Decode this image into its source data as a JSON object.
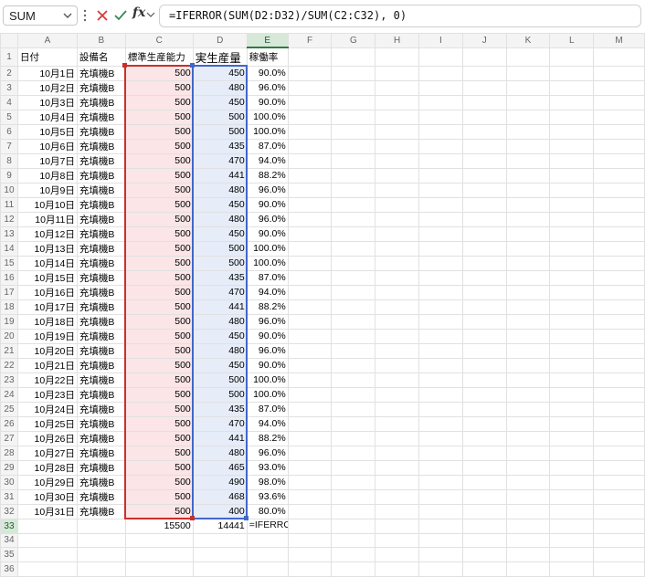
{
  "formula_bar": {
    "name_box": "SUM",
    "formula": "=IFERROR(SUM(D2:D32)/SUM(C2:C32), 0)",
    "fx_label": "fx"
  },
  "columns": [
    "A",
    "B",
    "C",
    "D",
    "E",
    "F",
    "G",
    "H",
    "I",
    "J",
    "K",
    "L",
    "M"
  ],
  "header_row": {
    "date": "日付",
    "equipment": "設備名",
    "std_capacity": "標準生産能力",
    "actual_output": "実生産量",
    "utilization": "稼働率"
  },
  "rows": [
    {
      "date": "10月1日",
      "equipment": "充填機B",
      "std": "500",
      "actual": "450",
      "rate": "90.0%"
    },
    {
      "date": "10月2日",
      "equipment": "充填機B",
      "std": "500",
      "actual": "480",
      "rate": "96.0%"
    },
    {
      "date": "10月3日",
      "equipment": "充填機B",
      "std": "500",
      "actual": "450",
      "rate": "90.0%"
    },
    {
      "date": "10月4日",
      "equipment": "充填機B",
      "std": "500",
      "actual": "500",
      "rate": "100.0%"
    },
    {
      "date": "10月5日",
      "equipment": "充填機B",
      "std": "500",
      "actual": "500",
      "rate": "100.0%"
    },
    {
      "date": "10月6日",
      "equipment": "充填機B",
      "std": "500",
      "actual": "435",
      "rate": "87.0%"
    },
    {
      "date": "10月7日",
      "equipment": "充填機B",
      "std": "500",
      "actual": "470",
      "rate": "94.0%"
    },
    {
      "date": "10月8日",
      "equipment": "充填機B",
      "std": "500",
      "actual": "441",
      "rate": "88.2%"
    },
    {
      "date": "10月9日",
      "equipment": "充填機B",
      "std": "500",
      "actual": "480",
      "rate": "96.0%"
    },
    {
      "date": "10月10日",
      "equipment": "充填機B",
      "std": "500",
      "actual": "450",
      "rate": "90.0%"
    },
    {
      "date": "10月11日",
      "equipment": "充填機B",
      "std": "500",
      "actual": "480",
      "rate": "96.0%"
    },
    {
      "date": "10月12日",
      "equipment": "充填機B",
      "std": "500",
      "actual": "450",
      "rate": "90.0%"
    },
    {
      "date": "10月13日",
      "equipment": "充填機B",
      "std": "500",
      "actual": "500",
      "rate": "100.0%"
    },
    {
      "date": "10月14日",
      "equipment": "充填機B",
      "std": "500",
      "actual": "500",
      "rate": "100.0%"
    },
    {
      "date": "10月15日",
      "equipment": "充填機B",
      "std": "500",
      "actual": "435",
      "rate": "87.0%"
    },
    {
      "date": "10月16日",
      "equipment": "充填機B",
      "std": "500",
      "actual": "470",
      "rate": "94.0%"
    },
    {
      "date": "10月17日",
      "equipment": "充填機B",
      "std": "500",
      "actual": "441",
      "rate": "88.2%"
    },
    {
      "date": "10月18日",
      "equipment": "充填機B",
      "std": "500",
      "actual": "480",
      "rate": "96.0%"
    },
    {
      "date": "10月19日",
      "equipment": "充填機B",
      "std": "500",
      "actual": "450",
      "rate": "90.0%"
    },
    {
      "date": "10月20日",
      "equipment": "充填機B",
      "std": "500",
      "actual": "480",
      "rate": "96.0%"
    },
    {
      "date": "10月21日",
      "equipment": "充填機B",
      "std": "500",
      "actual": "450",
      "rate": "90.0%"
    },
    {
      "date": "10月22日",
      "equipment": "充填機B",
      "std": "500",
      "actual": "500",
      "rate": "100.0%"
    },
    {
      "date": "10月23日",
      "equipment": "充填機B",
      "std": "500",
      "actual": "500",
      "rate": "100.0%"
    },
    {
      "date": "10月24日",
      "equipment": "充填機B",
      "std": "500",
      "actual": "435",
      "rate": "87.0%"
    },
    {
      "date": "10月25日",
      "equipment": "充填機B",
      "std": "500",
      "actual": "470",
      "rate": "94.0%"
    },
    {
      "date": "10月26日",
      "equipment": "充填機B",
      "std": "500",
      "actual": "441",
      "rate": "88.2%"
    },
    {
      "date": "10月27日",
      "equipment": "充填機B",
      "std": "500",
      "actual": "480",
      "rate": "96.0%"
    },
    {
      "date": "10月28日",
      "equipment": "充填機B",
      "std": "500",
      "actual": "465",
      "rate": "93.0%"
    },
    {
      "date": "10月29日",
      "equipment": "充填機B",
      "std": "500",
      "actual": "490",
      "rate": "98.0%"
    },
    {
      "date": "10月30日",
      "equipment": "充填機B",
      "std": "500",
      "actual": "468",
      "rate": "93.6%"
    },
    {
      "date": "10月31日",
      "equipment": "充填機B",
      "std": "500",
      "actual": "400",
      "rate": "80.0%"
    }
  ],
  "totals": {
    "std_total": "15500",
    "actual_total": "14441",
    "formula_parts": {
      "prefix": "=IFERROR(SUM(",
      "ref_d": "D2:D32",
      "middle": ")/SUM(",
      "ref_c": "C2:C32",
      "suffix": "), 0)"
    }
  },
  "colors": {
    "active_border": "#1d6b3a",
    "ref_c_color": "#c9302c",
    "ref_d_color": "#4267c9",
    "ref_c_fill": "#fbe5e6",
    "ref_d_fill": "#e6ecf8"
  },
  "icons": {
    "cancel": "close-x-icon",
    "enter": "check-icon",
    "more": "vertical-dots-icon",
    "dropdown": "chevron-down-icon"
  }
}
